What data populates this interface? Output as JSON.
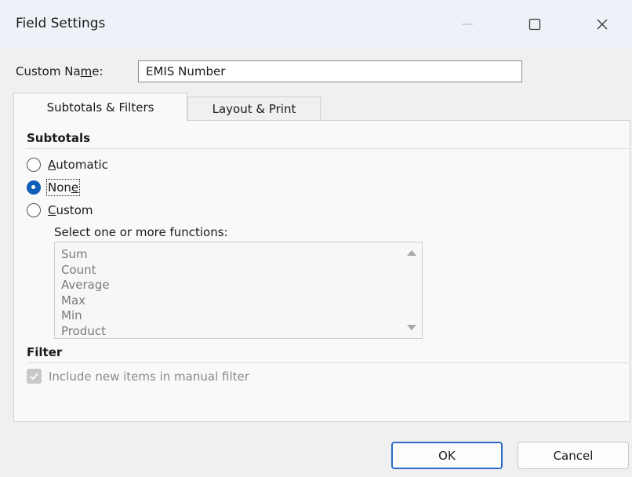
{
  "window": {
    "title": "Field Settings",
    "controls": {
      "minimize_icon": "minimize-icon",
      "maximize_icon": "maximize-icon",
      "close_icon": "close-icon"
    }
  },
  "custom_name": {
    "label_before": "Custom Na",
    "label_accel": "m",
    "label_after": "e:",
    "value": "EMIS Number"
  },
  "tabs": [
    {
      "label": "Subtotals & Filters",
      "active": true
    },
    {
      "label": "Layout & Print",
      "active": false
    }
  ],
  "subtotals": {
    "heading": "Subtotals",
    "options": [
      {
        "accel": "A",
        "rest": "utomatic",
        "checked": false
      },
      {
        "pre": "Non",
        "accel": "e",
        "checked": true
      },
      {
        "accel": "C",
        "rest": "ustom",
        "checked": false
      }
    ],
    "functions_label": "Select one or more functions:",
    "functions": [
      "Sum",
      "Count",
      "Average",
      "Max",
      "Min",
      "Product"
    ]
  },
  "filter": {
    "heading": "Filter",
    "include_new_items_label": "Include new items in manual filter",
    "include_new_items_checked": true
  },
  "buttons": {
    "ok": "OK",
    "cancel": "Cancel"
  },
  "colors": {
    "accent": "#0f5fb8",
    "ok_border": "#2a6cc7",
    "title_bar": "#eef1f7"
  }
}
